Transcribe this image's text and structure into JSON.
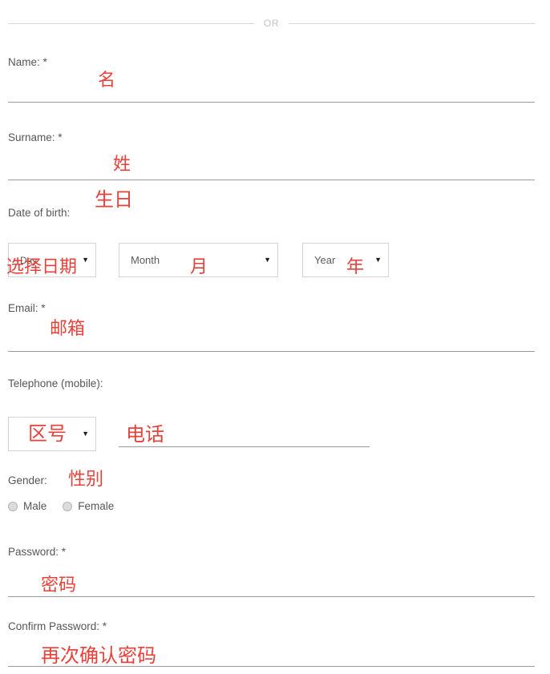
{
  "divider": {
    "or_label": "OR"
  },
  "colors": {
    "annotation_red": "#e8413a",
    "label_gray": "#565656",
    "rule_gray": "#9b9b9b",
    "divider_gray": "#d9d9d9",
    "select_border": "#d4d4d4"
  },
  "form": {
    "name": {
      "label": "Name: *",
      "value": "",
      "annotation": "名"
    },
    "surname": {
      "label": "Surname: *",
      "value": "",
      "annotation": "姓"
    },
    "date_of_birth": {
      "label": "Date of birth:",
      "annotation": "生日",
      "day": {
        "selected": "Day",
        "annotation": "选择日期",
        "caret": "▼"
      },
      "month": {
        "selected": "Month",
        "annotation": "月",
        "caret": "▼"
      },
      "year": {
        "selected": "Year",
        "annotation": "年",
        "caret": "▼"
      }
    },
    "email": {
      "label": "Email: *",
      "value": "",
      "annotation": "邮箱"
    },
    "telephone": {
      "label": "Telephone (mobile):",
      "area_code": {
        "selected": "",
        "annotation": "区号",
        "caret": "▼"
      },
      "number": {
        "value": "",
        "annotation": "电话"
      }
    },
    "gender": {
      "label": "Gender:",
      "annotation": "性别",
      "options": [
        {
          "label": "Male",
          "selected": false
        },
        {
          "label": "Female",
          "selected": false
        }
      ]
    },
    "password": {
      "label": "Password: *",
      "value": "",
      "annotation": "密码"
    },
    "confirm_password": {
      "label": "Confirm Password: *",
      "value": "",
      "annotation": "再次确认密码"
    }
  }
}
